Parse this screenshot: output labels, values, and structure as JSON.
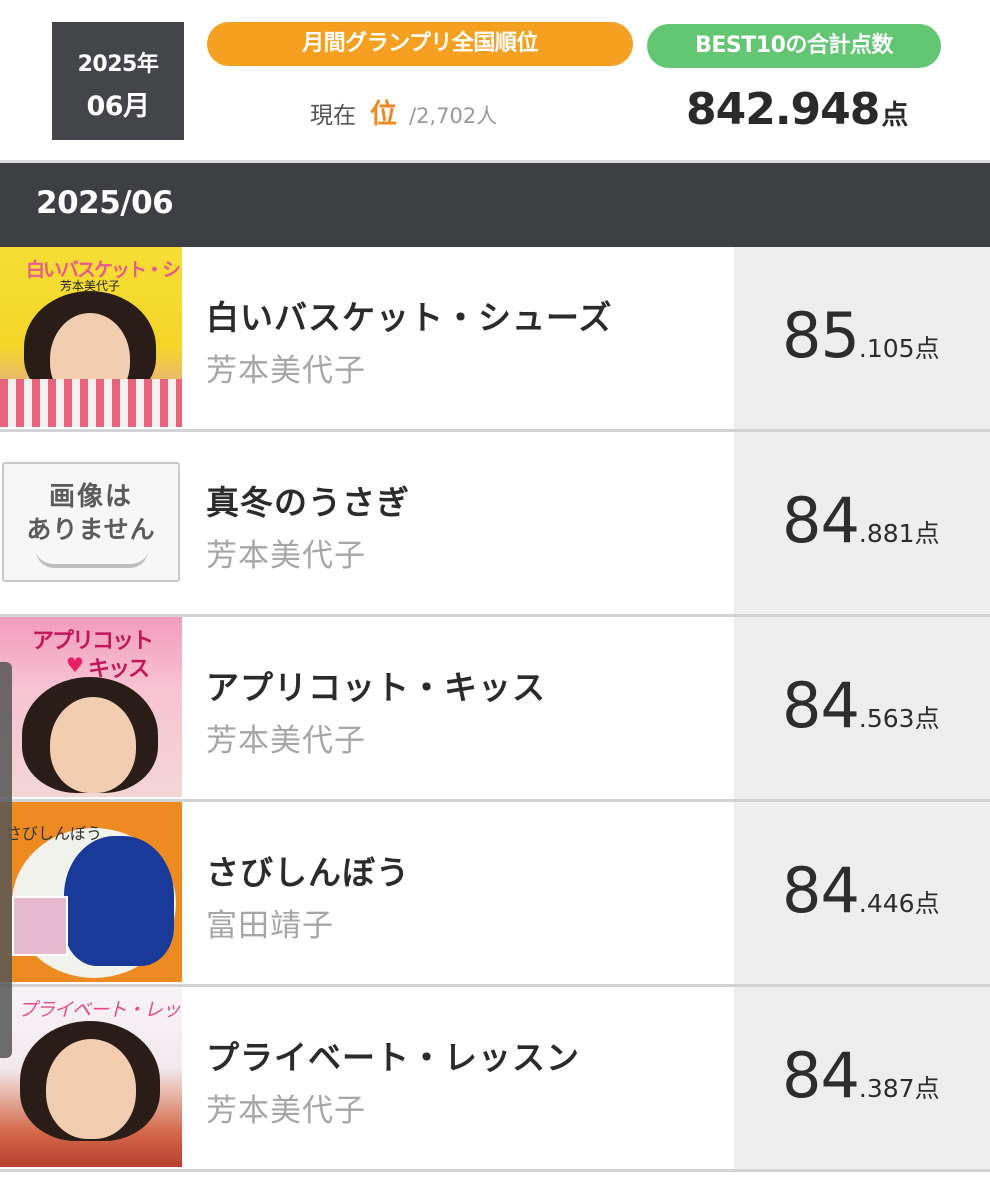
{
  "summary": {
    "year": "2025年",
    "month": "06月",
    "grand_prix_label": "月間グランプリ全国順位",
    "best10_label": "BEST10の合計点数",
    "rank_prefix": "現在",
    "rank_unit": "位",
    "rank_total": "/2,702人",
    "total_value": "842.948",
    "total_unit": "点"
  },
  "month_band": {
    "label": "2025/06"
  },
  "songs": [
    {
      "title": "白いバスケット・シューズ",
      "artist": "芳本美代子",
      "score_int": "85",
      "score_dec": ".105",
      "score_unit": "点",
      "cover": {
        "kind": "image",
        "text": "白いバスケット・シューズ",
        "subtext": "芳本美代子"
      }
    },
    {
      "title": "真冬のうさぎ",
      "artist": "芳本美代子",
      "score_int": "84",
      "score_dec": ".881",
      "score_unit": "点",
      "cover": {
        "kind": "placeholder",
        "line1": "画像は",
        "line2": "ありません"
      }
    },
    {
      "title": "アプリコット・キッス",
      "artist": "芳本美代子",
      "score_int": "84",
      "score_dec": ".563",
      "score_unit": "点",
      "cover": {
        "kind": "image",
        "text_a": "アプリコット",
        "text_b": "キッス"
      }
    },
    {
      "title": "さびしんぼう",
      "artist": "富田靖子",
      "score_int": "84",
      "score_dec": ".446",
      "score_unit": "点",
      "cover": {
        "kind": "image",
        "text": "さびしんぼう"
      }
    },
    {
      "title": "プライベート・レッスン",
      "artist": "芳本美代子",
      "score_int": "84",
      "score_dec": ".387",
      "score_unit": "点",
      "cover": {
        "kind": "image",
        "text": "プライベート・レッスン"
      }
    }
  ],
  "colors": {
    "rank_pill": "#f5a020",
    "best10_pill": "#62c673",
    "rank_accent": "#f08a1e",
    "date_box": "#434548",
    "month_band": "#3d3f42",
    "score_panel": "#eeeeee"
  },
  "icons": [
    "heart-icon"
  ]
}
